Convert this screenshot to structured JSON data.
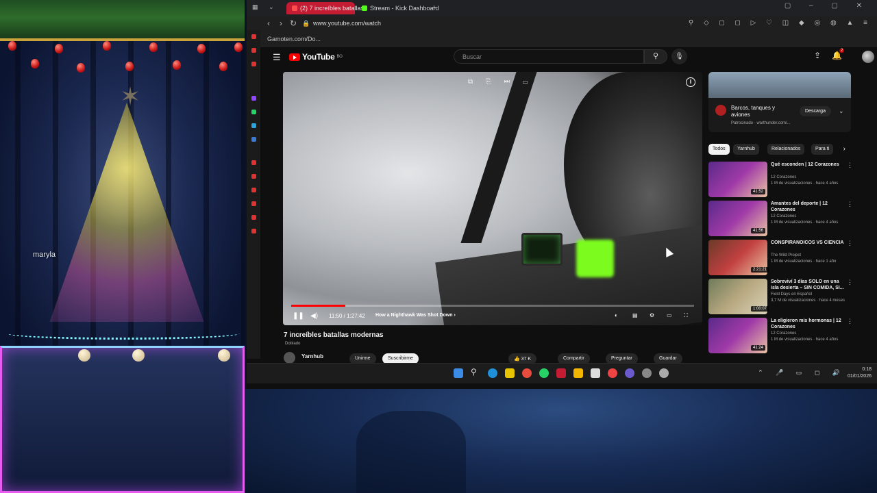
{
  "overlay": {
    "streamer_name": "maryla"
  },
  "browser": {
    "tabs": [
      {
        "label": "(2) 7 increíbles batallas",
        "active": true
      },
      {
        "label": "Stream - Kick Dashboard",
        "active": false
      }
    ],
    "url": "www.youtube.com/watch",
    "bookmark": "Gamoten.com/Do..."
  },
  "youtube": {
    "logo_text": "YouTube",
    "country_code": "BO",
    "search_placeholder": "Buscar",
    "notification_count": "2",
    "player": {
      "current_time": "11:50",
      "duration": "1:27:42",
      "time_display": "11:50 / 1:27:42",
      "chapter": "How a Nighthawk Was Shot Down",
      "progress_fraction": 0.135
    },
    "video": {
      "title": "7 increíbles batallas modernas",
      "dub_label": "Doblado",
      "channel": "Yarnhub",
      "join_label": "Unirme",
      "subscribe_label": "Suscribirme",
      "likes": "37 K",
      "share_label": "Compartir",
      "ask_label": "Preguntar",
      "save_label": "Guardar"
    },
    "ad": {
      "title": "Barcos, tanques y aviones",
      "sponsor": "Patrocinado · warthunder.com/...",
      "cta": "Descarga"
    },
    "chips": [
      "Todos",
      "Yarnhub",
      "Relacionados",
      "Para ti"
    ],
    "recommendations": [
      {
        "title": "Qué esconden | 12 Corazones",
        "channel": "12 Corazones",
        "meta": "1 M de visualizaciones · hace 4 años",
        "duration": "41:52"
      },
      {
        "title": "Amantes del deporte | 12 Corazones",
        "channel": "12 Corazones",
        "meta": "1 M de visualizaciones · hace 4 años",
        "duration": "41:56"
      },
      {
        "title": "CONSPIRANOICOS VS CIENCIA",
        "channel": "The Wild Project",
        "meta": "1 M de visualizaciones · hace 1 año",
        "duration": "2:21:21"
      },
      {
        "title": "Sobreviví 3 días SOLO en una isla desierta – SIN COMIDA, SI...",
        "channel": "Field Days en Español",
        "meta": "3,7 M de visualizaciones · hace 4 meses",
        "duration": "1:00:07"
      },
      {
        "title": "La eligieron mis hormonas | 12 Corazones",
        "channel": "12 Corazones",
        "meta": "1 M de visualizaciones · hace 4 años",
        "duration": "41:24"
      }
    ]
  },
  "taskbar": {
    "time": "0:18",
    "date": "01/01/2026"
  },
  "colors": {
    "youtube_red": "#ff0000",
    "active_tab": "#c31c33",
    "webcam_border": "#e65cf0",
    "lights": "#7bf7ff"
  }
}
